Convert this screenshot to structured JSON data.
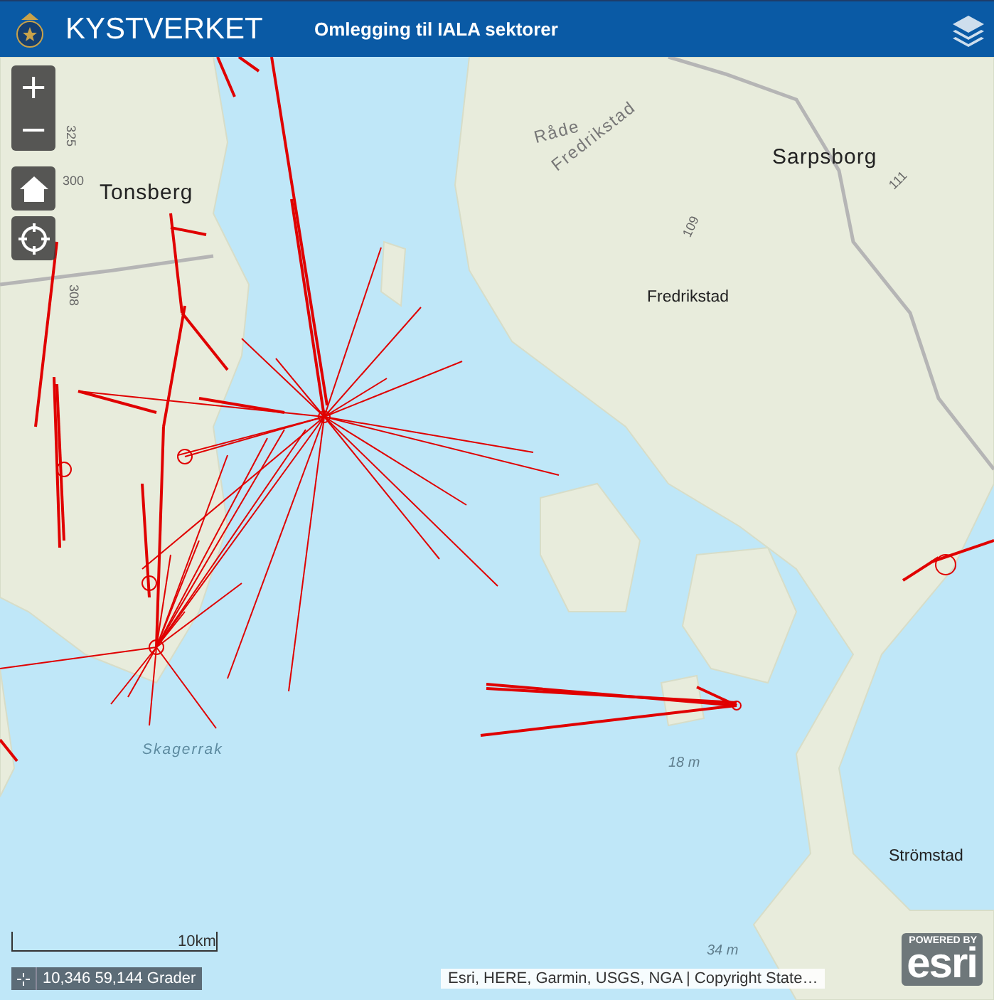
{
  "header": {
    "title": "KYSTVERKET",
    "subtitle": "Omlegging til IALA sektorer"
  },
  "map_controls": {
    "zoom_in": "+",
    "zoom_out": "−"
  },
  "map_labels": [
    {
      "text": "Tonsberg",
      "kind": "city"
    },
    {
      "text": "Sarpsborg",
      "kind": "city"
    },
    {
      "text": "Fredrikstad",
      "kind": "town"
    },
    {
      "text": "Råde",
      "kind": "municipality"
    },
    {
      "text": "Fredrikstad",
      "kind": "municipality"
    },
    {
      "text": "Skagerrak",
      "kind": "sea"
    },
    {
      "text": "Strömstad",
      "kind": "town"
    },
    {
      "text": "325",
      "kind": "road"
    },
    {
      "text": "300",
      "kind": "road"
    },
    {
      "text": "308",
      "kind": "road"
    },
    {
      "text": "109",
      "kind": "road"
    },
    {
      "text": "111",
      "kind": "road"
    },
    {
      "text": "18 m",
      "kind": "depth"
    },
    {
      "text": "34 m",
      "kind": "depth"
    }
  ],
  "scale_bar": {
    "label": "10km"
  },
  "coordinates": {
    "value": "10,346 59,144 Grader"
  },
  "attribution": "Esri, HERE, Garmin, USGS, NGA | Copyright State…",
  "esri_logo": {
    "tagline": "POWERED BY",
    "wordmark": "esri"
  }
}
